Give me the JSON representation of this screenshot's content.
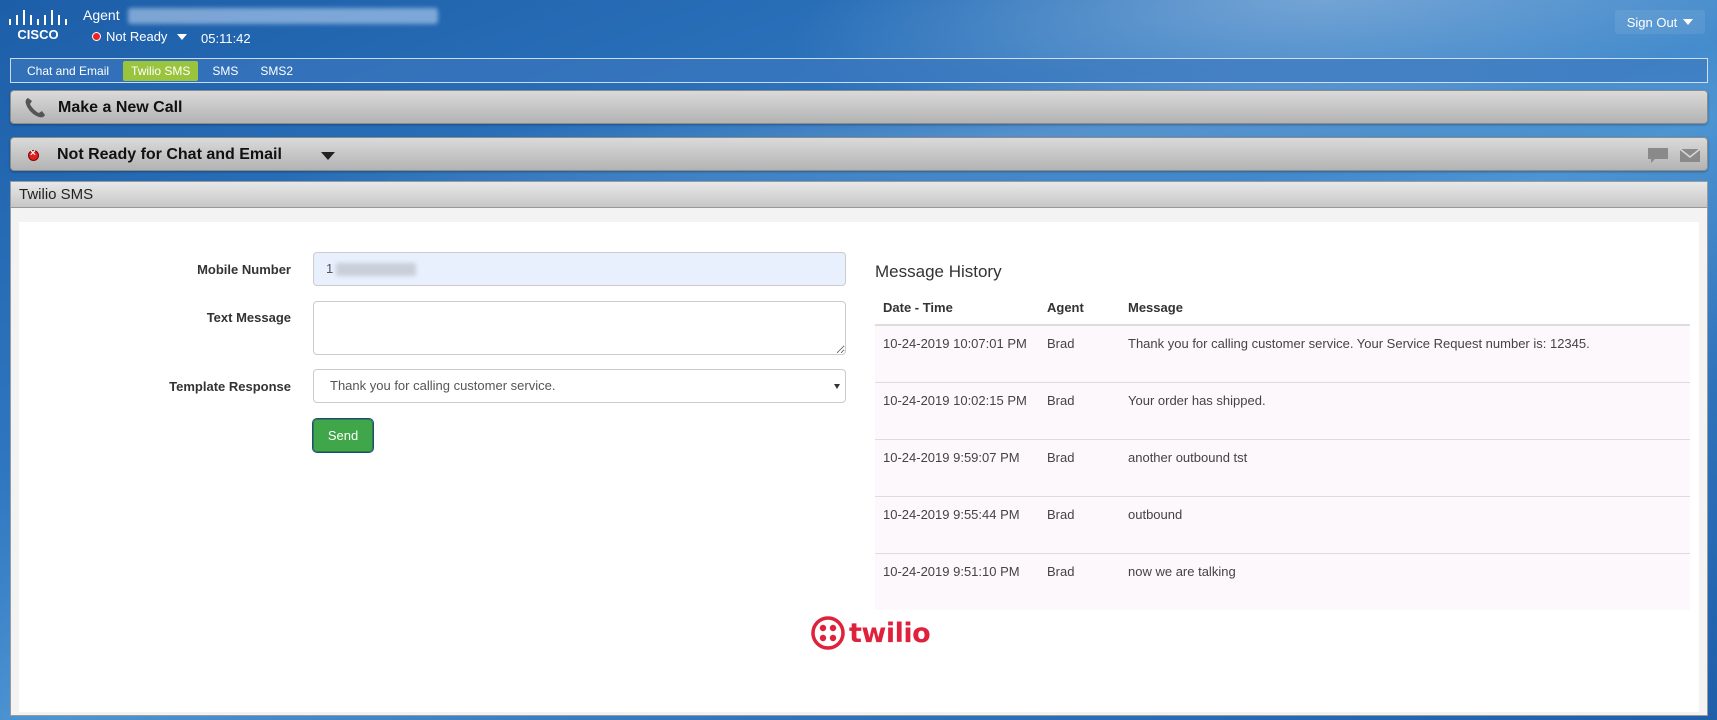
{
  "header": {
    "logo_text": "CISCO",
    "agent_label": "Agent",
    "state": "Not Ready",
    "timer": "05:11:42",
    "sign_out": "Sign Out"
  },
  "tabs": [
    {
      "label": "Chat and Email",
      "active": false
    },
    {
      "label": "Twilio SMS",
      "active": true
    },
    {
      "label": "SMS",
      "active": false
    },
    {
      "label": "SMS2",
      "active": false
    }
  ],
  "call_bar": {
    "title": "Make a New Call"
  },
  "status_bar": {
    "title": "Not Ready for Chat and Email"
  },
  "panel": {
    "title": "Twilio SMS"
  },
  "form": {
    "mobile_label": "Mobile Number",
    "mobile_value": "1",
    "text_label": "Text Message",
    "text_value": "",
    "template_label": "Template Response",
    "template_value": "Thank you for calling customer service.",
    "send_label": "Send"
  },
  "history": {
    "title": "Message History",
    "columns": [
      "Date - Time",
      "Agent",
      "Message"
    ],
    "rows": [
      {
        "date": "10-24-2019 10:07:01 PM",
        "agent": "Brad",
        "message": "Thank you for calling customer service. Your Service Request number is: 12345."
      },
      {
        "date": "10-24-2019 10:02:15 PM",
        "agent": "Brad",
        "message": "Your order has shipped."
      },
      {
        "date": "10-24-2019 9:59:07 PM",
        "agent": "Brad",
        "message": "another outbound tst"
      },
      {
        "date": "10-24-2019 9:55:44 PM",
        "agent": "Brad",
        "message": "outbound"
      },
      {
        "date": "10-24-2019 9:51:10 PM",
        "agent": "Brad",
        "message": "now we are talking"
      }
    ]
  },
  "footer": {
    "logo_text": "twilio"
  },
  "colors": {
    "accent_tab": "#9ac43d",
    "send_button": "#3fa74a",
    "twilio_red": "#e0213b"
  }
}
